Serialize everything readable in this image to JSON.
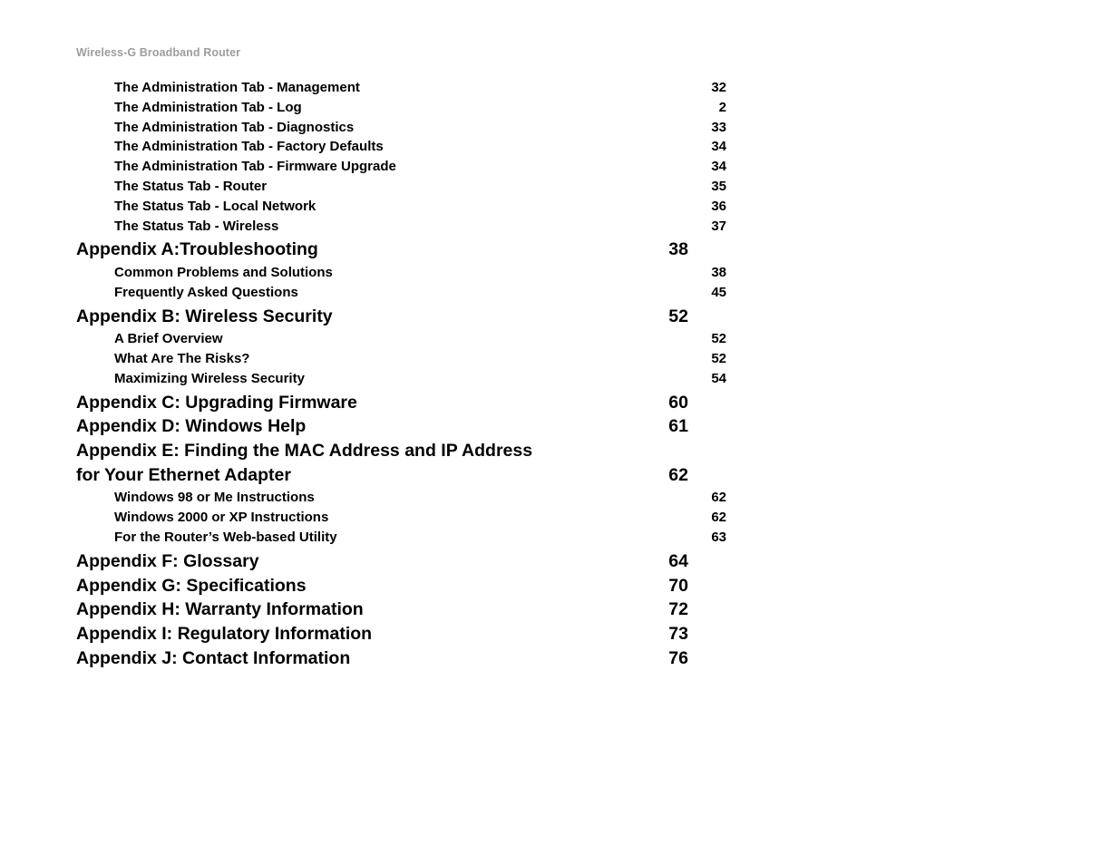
{
  "document": {
    "running_header": "Wireless-G Broadband Router",
    "header_color": "#9d9d9d",
    "text_color": "#000000",
    "background": "#ffffff"
  },
  "toc": {
    "entries": [
      {
        "level": 2,
        "label": "The Administration Tab - Management",
        "page": "32"
      },
      {
        "level": 2,
        "label": "The Administration Tab - Log",
        "page": "2"
      },
      {
        "level": 2,
        "label": "The Administration Tab - Diagnostics",
        "page": "33"
      },
      {
        "level": 2,
        "label": "The Administration Tab - Factory Defaults",
        "page": "34"
      },
      {
        "level": 2,
        "label": "The Administration Tab - Firmware Upgrade",
        "page": "34"
      },
      {
        "level": 2,
        "label": "The Status Tab - Router",
        "page": "35"
      },
      {
        "level": 2,
        "label": "The Status Tab - Local Network",
        "page": "36"
      },
      {
        "level": 2,
        "label": "The Status Tab - Wireless",
        "page": "37"
      },
      {
        "level": 1,
        "label": "Appendix A:Troubleshooting",
        "page": "38"
      },
      {
        "level": 2,
        "label": "Common Problems and Solutions",
        "page": "38"
      },
      {
        "level": 2,
        "label": "Frequently Asked Questions",
        "page": "45"
      },
      {
        "level": 1,
        "label": "Appendix B: Wireless Security",
        "page": "52"
      },
      {
        "level": 2,
        "label": "A Brief Overview",
        "page": "52"
      },
      {
        "level": 2,
        "label": "What Are The Risks?",
        "page": "52"
      },
      {
        "level": 2,
        "label": "Maximizing Wireless Security",
        "page": "54"
      },
      {
        "level": 1,
        "label": "Appendix C: Upgrading Firmware",
        "page": "60"
      },
      {
        "level": 1,
        "label": "Appendix D: Windows Help",
        "page": "61"
      },
      {
        "level": 1,
        "label": "Appendix E: Finding the MAC Address and IP Address",
        "page": ""
      },
      {
        "level": 1,
        "label": "for Your Ethernet Adapter",
        "page": "62"
      },
      {
        "level": 2,
        "label": "Windows 98 or Me Instructions",
        "page": "62"
      },
      {
        "level": 2,
        "label": "Windows 2000 or XP Instructions",
        "page": "62"
      },
      {
        "level": 2,
        "label": "For the Router’s Web-based Utility",
        "page": "63"
      },
      {
        "level": 1,
        "label": "Appendix F: Glossary",
        "page": "64"
      },
      {
        "level": 1,
        "label": "Appendix G: Specifications",
        "page": "70"
      },
      {
        "level": 1,
        "label": "Appendix H: Warranty Information",
        "page": "72"
      },
      {
        "level": 1,
        "label": "Appendix I: Regulatory Information",
        "page": "73"
      },
      {
        "level": 1,
        "label": "Appendix J: Contact Information",
        "page": "76"
      }
    ]
  }
}
